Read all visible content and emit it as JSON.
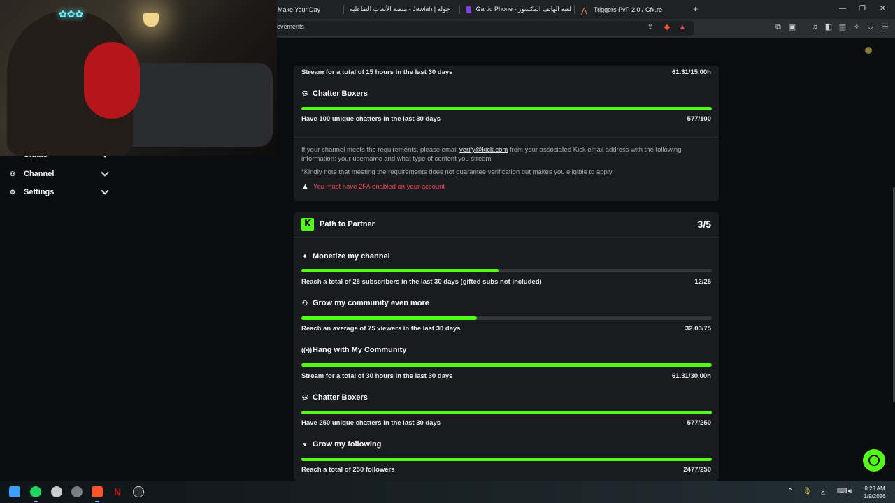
{
  "browser": {
    "tabs": [
      {
        "title": "Make Your Day"
      },
      {
        "title": "جولة | Jawlah - منصة الألعاب التفاعلية"
      },
      {
        "title": "Gartic Phone - لعبة الهاتف المكسور"
      },
      {
        "title": "Triggers PvP 2.0 / Cfx.re"
      }
    ],
    "new_tab": "+",
    "url": "ievements"
  },
  "sidebar": {
    "items": [
      {
        "label": "Studio"
      },
      {
        "label": "Channel"
      },
      {
        "label": "Settings"
      }
    ]
  },
  "verified_card": {
    "goals": [
      {
        "title": "",
        "description": "Stream for a total of 15 hours in the last 30 days",
        "value": "61.31/15.00h",
        "progress": 1.0
      },
      {
        "title": "Chatter Boxers",
        "description": "Have 100 unique chatters in the last 30 days",
        "value": "577/100",
        "progress": 1.0
      }
    ],
    "info_line1_pre": "If your channel meets the requirements, please email ",
    "info_email": "verify@kick.com",
    "info_line1_post": " from your associated Kick email address with the following information: your username and what type of content you stream.",
    "info_line2": "*Kindly note that meeting the requirements does not guarantee verification but makes you eligible to apply.",
    "warning": "You must have 2FA enabled on your account"
  },
  "partner_card": {
    "title": "Path to Partner",
    "count": "3/5",
    "goals": [
      {
        "title": "Monetize my channel",
        "description": "Reach a total of 25 subscribers in the last 30 days (gifted subs not included)",
        "value": "12/25",
        "progress": 0.48
      },
      {
        "title": "Grow my community even more",
        "description": "Reach an average of 75 viewers in the last 30 days",
        "value": "32.03/75",
        "progress": 0.427
      },
      {
        "title": "Hang with My Community",
        "description": "Stream for a total of 30 hours in the last 30 days",
        "value": "61.31/30.00h",
        "progress": 1.0
      },
      {
        "title": "Chatter Boxers",
        "description": "Have 250 unique chatters in the last 30 days",
        "value": "577/250",
        "progress": 1.0
      },
      {
        "title": "Grow my following",
        "description": "Reach a total of 250 followers",
        "value": "2477/250",
        "progress": 1.0
      }
    ]
  },
  "colors": {
    "accent": "#53fc18",
    "warning": "#f0475a",
    "card_bg": "#191b1f",
    "track": "#33363b"
  },
  "taskbar": {
    "time": "8:23 AM",
    "date": "1/9/2026",
    "lang": "ع"
  }
}
